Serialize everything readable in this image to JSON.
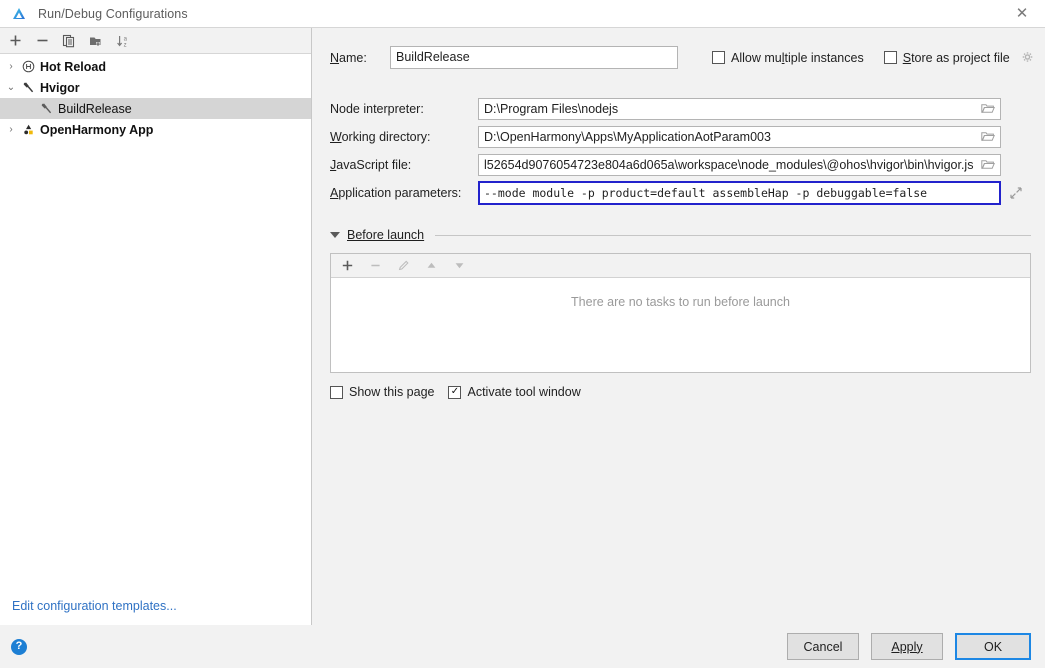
{
  "window": {
    "title": "Run/Debug Configurations",
    "app_icon": "deveco-studio-icon",
    "close_label": "✕"
  },
  "left_panel": {
    "toolbar": [
      {
        "name": "add",
        "glyph": "＋"
      },
      {
        "name": "remove",
        "glyph": "−"
      },
      {
        "name": "copy",
        "glyph": "❐"
      },
      {
        "name": "save-as-folder",
        "glyph": "◨"
      },
      {
        "name": "sort-alphabetically",
        "glyph": "↓"
      }
    ],
    "tree": [
      {
        "label": "Hot Reload",
        "icon": "circled-h-icon",
        "bold": true,
        "depth": 0,
        "twisty": "›",
        "selected": false
      },
      {
        "label": "Hvigor",
        "icon": "hammer-icon",
        "bold": true,
        "depth": 0,
        "twisty": "⌄",
        "selected": false
      },
      {
        "label": "BuildRelease",
        "icon": "hammer-icon",
        "bold": false,
        "depth": 1,
        "twisty": "",
        "selected": true
      },
      {
        "label": "OpenHarmony App",
        "icon": "openharmony-icon",
        "bold": true,
        "depth": 0,
        "twisty": "›",
        "selected": false
      }
    ],
    "footer_link": "Edit configuration templates..."
  },
  "form": {
    "name_label": "Name:",
    "name_value": "BuildRelease",
    "allow_multiple_instances": {
      "label": "Allow multiple instances",
      "checked": false,
      "check_glyph": ""
    },
    "store_as_project_file": {
      "label": "Store as project file",
      "checked": false,
      "check_glyph": "",
      "gear_icon": "gear-icon"
    },
    "fields": [
      {
        "label": "Node interpreter:",
        "value": "D:\\Program Files\\nodejs",
        "has_browse": true,
        "focused": false,
        "mono": false
      },
      {
        "label": "Working directory:",
        "value": "D:\\OpenHarmony\\Apps\\MyApplicationAotParam003",
        "has_browse": true,
        "focused": false,
        "mono": false
      },
      {
        "label": "JavaScript file:",
        "value": "l52654d9076054723e804a6d065a\\workspace\\node_modules\\@ohos\\hvigor\\bin\\hvigor.js",
        "has_browse": true,
        "focused": false,
        "mono": false
      },
      {
        "label": "Application parameters:",
        "value": "--mode module -p product=default assembleHap -p debuggable=false",
        "has_browse": false,
        "focused": true,
        "mono": true,
        "expand_icon": "expand-editor-icon"
      }
    ]
  },
  "before_launch": {
    "title": "Before launch",
    "toolbar": [
      {
        "name": "add-task",
        "glyph": "＋",
        "dim": false
      },
      {
        "name": "remove-task",
        "glyph": "−",
        "dim": true
      },
      {
        "name": "edit-task",
        "glyph": "✐",
        "dim": true
      },
      {
        "name": "move-up",
        "glyph": "▲",
        "dim": true
      },
      {
        "name": "move-down",
        "glyph": "▼",
        "dim": true
      }
    ],
    "empty_text": "There are no tasks to run before launch",
    "show_this_page": {
      "label": "Show this page",
      "checked": false,
      "check_glyph": ""
    },
    "activate_tool_window": {
      "label": "Activate tool window",
      "checked": true,
      "check_glyph": "✓"
    }
  },
  "footer": {
    "help_glyph": "?",
    "buttons": [
      {
        "name": "cancel",
        "label": "Cancel",
        "primary": false
      },
      {
        "name": "apply",
        "label": "Apply",
        "primary": false
      },
      {
        "name": "ok",
        "label": "OK",
        "primary": true
      }
    ]
  },
  "colors": {
    "accent_blue": "#1d87e4",
    "link_blue": "#2f72c4",
    "focus_border": "#2222cc",
    "panel_bg": "#f2f2f2",
    "selection": "#d5d5d5"
  }
}
